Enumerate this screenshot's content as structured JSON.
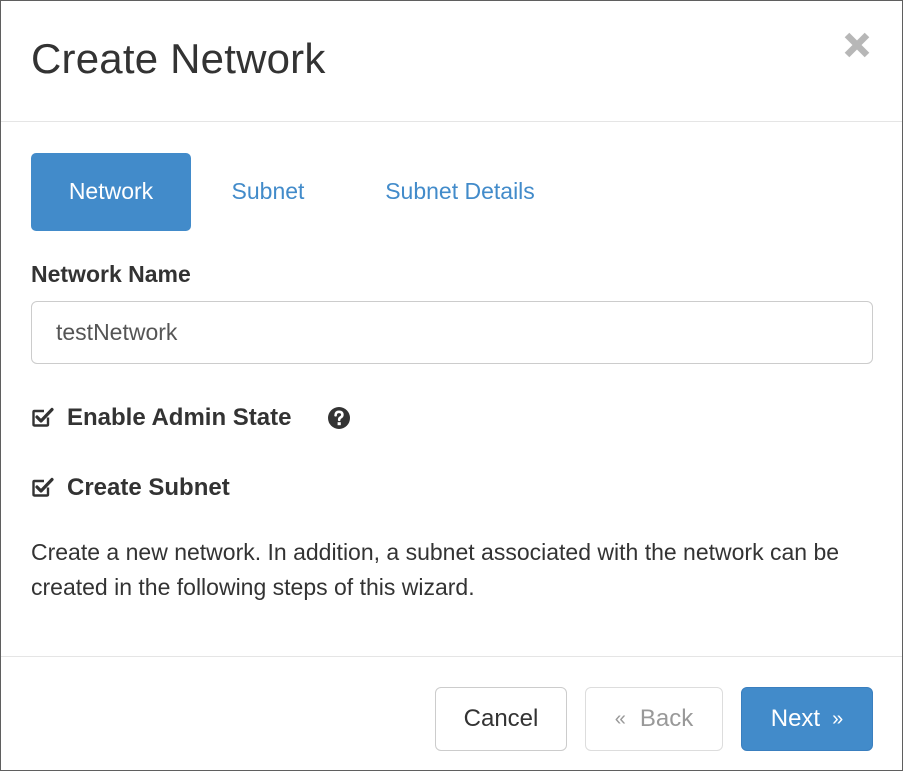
{
  "header": {
    "title": "Create Network"
  },
  "tabs": [
    {
      "label": "Network",
      "active": true
    },
    {
      "label": "Subnet",
      "active": false
    },
    {
      "label": "Subnet Details",
      "active": false
    }
  ],
  "form": {
    "network_name": {
      "label": "Network Name",
      "value": "testNetwork",
      "placeholder": ""
    },
    "enable_admin_state": {
      "label": "Enable Admin State",
      "checked": true
    },
    "create_subnet": {
      "label": "Create Subnet",
      "checked": true
    }
  },
  "description": "Create a new network. In addition, a subnet associated with the network can be created in the following steps of this wizard.",
  "footer": {
    "cancel_label": "Cancel",
    "back_label": "Back",
    "back_chevron": "«",
    "next_label": "Next",
    "next_chevron": "»"
  },
  "icons": {
    "close": "close-icon",
    "checkbox": "checkbox-checked-icon",
    "help": "question-circle-icon"
  },
  "colors": {
    "primary": "#428bca",
    "text": "#333333",
    "muted": "#999999",
    "border": "#cccccc"
  }
}
